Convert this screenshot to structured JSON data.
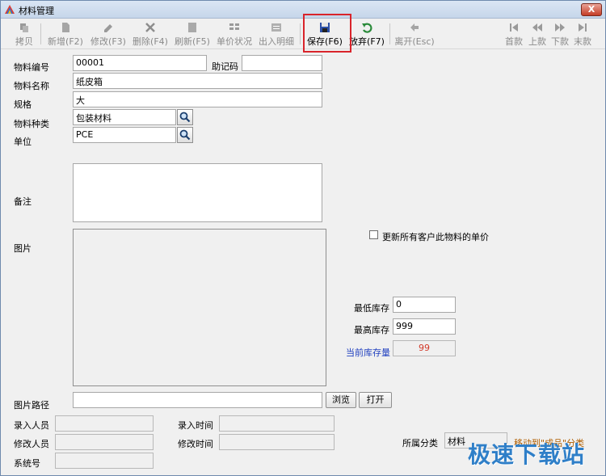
{
  "window": {
    "title": "材料管理",
    "close_label": "X"
  },
  "toolbar": {
    "copy": "拷贝",
    "new": "新增(F2)",
    "edit": "修改(F3)",
    "delete": "删除(F4)",
    "refresh": "刷新(F5)",
    "price_status": "单价状况",
    "io_detail": "出入明细",
    "save": "保存(F6)",
    "discard": "放弃(F7)",
    "leave": "离开(Esc)",
    "first": "首款",
    "prev": "上款",
    "next": "下款",
    "last": "末款"
  },
  "form": {
    "code_label": "物料编号",
    "code_value": "00001",
    "mnemonic_label": "助记码",
    "mnemonic_value": "",
    "name_label": "物料名称",
    "name_value": "纸皮箱",
    "spec_label": "规格",
    "spec_value": "大",
    "type_label": "物料种类",
    "type_value": "包装材料",
    "unit_label": "单位",
    "unit_value": "PCE",
    "remark_label": "备注",
    "picture_label": "图片",
    "update_price_label": "更新所有客户此物料的单价",
    "min_stock_label": "最低库存",
    "min_stock_value": "0",
    "max_stock_label": "最高库存",
    "max_stock_value": "999",
    "current_stock_label": "当前库存量",
    "current_stock_value": "99",
    "path_label": "图片路径",
    "path_value": "",
    "browse_label": "浏览",
    "open_label": "打开",
    "entered_by_label": "录入人员",
    "entered_time_label": "录入时间",
    "modified_by_label": "修改人员",
    "modified_time_label": "修改时间",
    "system_no_label": "系统号",
    "category_label": "所属分类",
    "category_value": "材料",
    "move_label": "移动到\"成品\"分类"
  },
  "watermark": "极速下载站",
  "colors": {
    "highlight": "#d9242b",
    "stock_value": "#d23a2a",
    "stock_label": "#1f3fbf"
  }
}
